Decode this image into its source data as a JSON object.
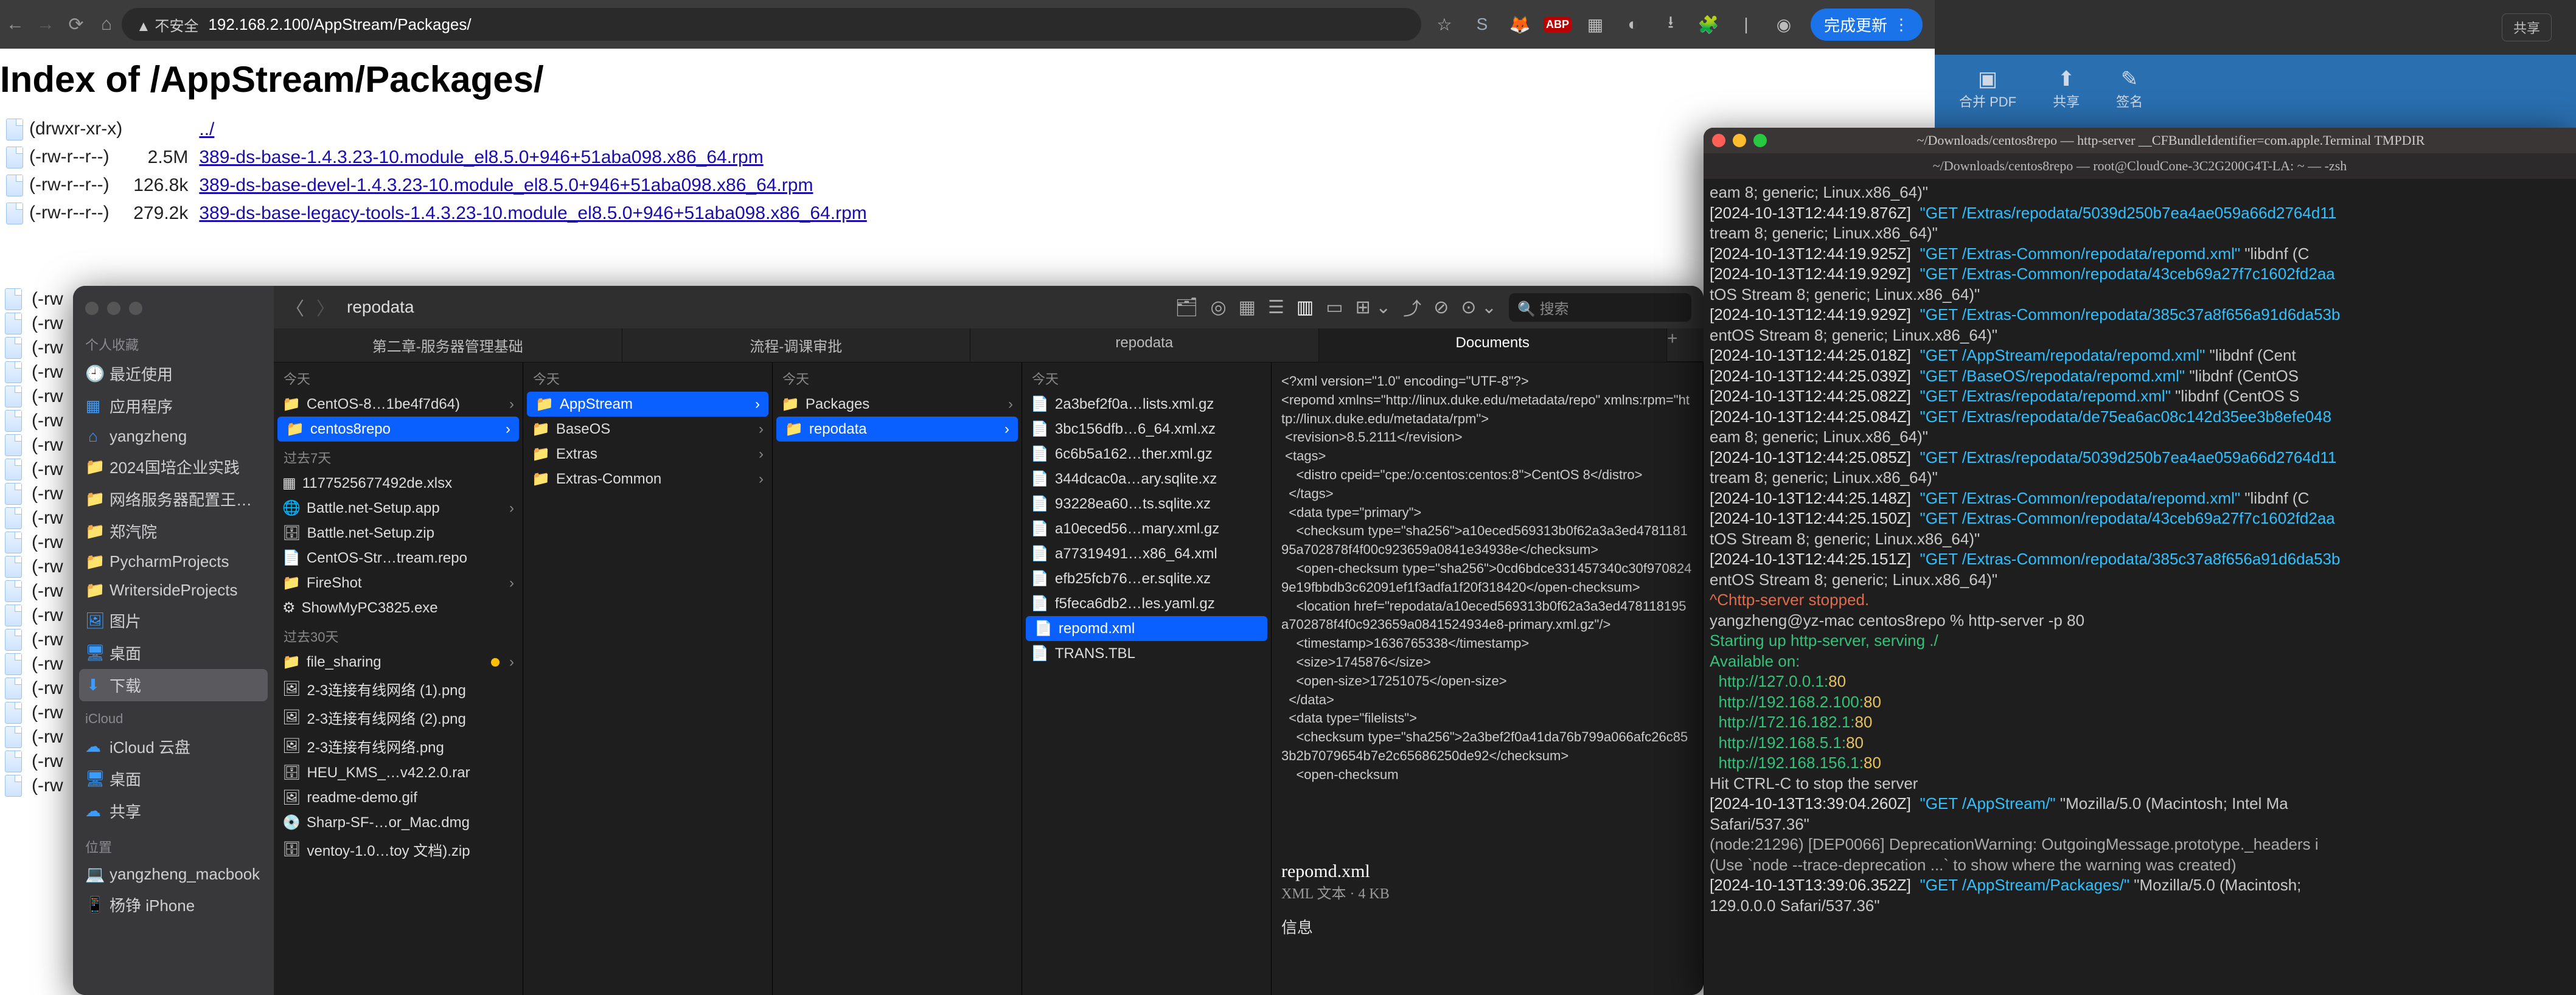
{
  "browser": {
    "security_badge": "▲ 不安全",
    "url": "192.168.2.100/AppStream/Packages/",
    "update_btn": "完成更新",
    "right_icons": [
      "star",
      "S",
      "fox",
      "abp",
      "grid",
      "ext",
      "dl",
      "puzzle",
      "sep",
      "globe"
    ]
  },
  "page": {
    "title": "Index of /AppStream/Packages/",
    "rows": [
      {
        "perm": "(drwxr-xr-x)",
        "size": "",
        "name": "../"
      },
      {
        "perm": "(-rw-r--r--)",
        "size": "2.5M",
        "name": "389-ds-base-1.4.3.23-10.module_el8.5.0+946+51aba098.x86_64.rpm"
      },
      {
        "perm": "(-rw-r--r--)",
        "size": "126.8k",
        "name": "389-ds-base-devel-1.4.3.23-10.module_el8.5.0+946+51aba098.x86_64.rpm"
      },
      {
        "perm": "(-rw-r--r--)",
        "size": "279.2k",
        "name": "389-ds-base-legacy-tools-1.4.3.23-10.module_el8.5.0+946+51aba098.x86_64.rpm"
      }
    ]
  },
  "stray_perms": [
    "(-rw",
    "(-rw",
    "(-rw",
    "(-rw",
    "(-rw",
    "(-rw",
    "(-rw",
    "(-rw",
    "(-rw",
    "(-rw",
    "(-rw",
    "(-rw",
    "(-rw",
    "(-rw",
    "(-rw",
    "(-rw",
    "(-rw",
    "(-rw",
    "(-rw",
    "(-rw",
    "(-rw"
  ],
  "finder": {
    "title": "repodata",
    "search_placeholder": "搜索",
    "sidebar": {
      "fav_head": "个人收藏",
      "fav": [
        {
          "icon": "🕘",
          "label": "最近使用"
        },
        {
          "icon": "▦",
          "label": "应用程序"
        },
        {
          "icon": "⌂",
          "label": "yangzheng"
        },
        {
          "icon": "📁",
          "label": "2024国培企业实践"
        },
        {
          "icon": "📁",
          "label": "网络服务器配置王…"
        },
        {
          "icon": "📁",
          "label": "郑汽院"
        },
        {
          "icon": "📁",
          "label": "PycharmProjects"
        },
        {
          "icon": "📁",
          "label": "WritersideProjects"
        },
        {
          "icon": "🖼",
          "label": "图片"
        },
        {
          "icon": "🖥",
          "label": "桌面",
          "sel": false
        },
        {
          "icon": "⬇",
          "label": "下载",
          "sel": true
        }
      ],
      "icloud_head": "iCloud",
      "icloud": [
        {
          "icon": "☁",
          "label": "iCloud 云盘"
        },
        {
          "icon": "🖥",
          "label": "桌面"
        },
        {
          "icon": "☁",
          "label": "共享"
        }
      ],
      "loc_head": "位置",
      "loc": [
        {
          "icon": "💻",
          "label": "yangzheng_macbook"
        },
        {
          "icon": "📱",
          "label": "杨铮 iPhone"
        }
      ]
    },
    "tabs": [
      {
        "label": "第二章-服务器管理基础"
      },
      {
        "label": "流程-调课审批"
      },
      {
        "label": "repodata"
      },
      {
        "label": "Documents",
        "act": true
      }
    ],
    "col1": {
      "groups": [
        {
          "head": "今天",
          "items": [
            {
              "icon": "📁",
              "label": "CentOS-8…1be4f7d64)",
              "chev": true
            },
            {
              "icon": "📁",
              "label": "centos8repo",
              "chev": true,
              "sel": true
            }
          ]
        },
        {
          "head": "过去7天",
          "items": [
            {
              "icon": "▦",
              "label": "1177525677492de.xlsx"
            },
            {
              "icon": "🌐",
              "label": "Battle.net-Setup.app",
              "chev": true
            },
            {
              "icon": "🗄",
              "label": "Battle.net-Setup.zip"
            },
            {
              "icon": "📄",
              "label": "CentOS-Str…tream.repo"
            },
            {
              "icon": "📁",
              "label": "FireShot",
              "chev": true
            },
            {
              "icon": "⚙",
              "label": "ShowMyPC3825.exe"
            }
          ]
        },
        {
          "head": "过去30天",
          "items": [
            {
              "icon": "📁",
              "label": "file_sharing",
              "dot": true,
              "chev": true
            },
            {
              "icon": "🖼",
              "label": "2-3连接有线网络 (1).png"
            },
            {
              "icon": "🖼",
              "label": "2-3连接有线网络 (2).png"
            },
            {
              "icon": "🖼",
              "label": "2-3连接有线网络.png"
            },
            {
              "icon": "🗄",
              "label": "HEU_KMS_…v42.2.0.rar"
            },
            {
              "icon": "🖼",
              "label": "readme-demo.gif"
            },
            {
              "icon": "💿",
              "label": "Sharp-SF-…or_Mac.dmg"
            },
            {
              "icon": "🗄",
              "label": "ventoy-1.0…toy 文档).zip"
            }
          ]
        }
      ]
    },
    "col2": {
      "groups": [
        {
          "head": "今天",
          "items": [
            {
              "icon": "📁",
              "label": "AppStream",
              "chev": true,
              "sel": true
            },
            {
              "icon": "📁",
              "label": "BaseOS",
              "chev": true
            },
            {
              "icon": "📁",
              "label": "Extras",
              "chev": true
            },
            {
              "icon": "📁",
              "label": "Extras-Common",
              "chev": true
            }
          ]
        }
      ]
    },
    "col3": {
      "groups": [
        {
          "head": "今天",
          "items": [
            {
              "icon": "📁",
              "label": "Packages",
              "chev": true
            },
            {
              "icon": "📁",
              "label": "repodata",
              "chev": true,
              "sel": true
            }
          ]
        }
      ]
    },
    "col4": {
      "groups": [
        {
          "head": "今天",
          "items": [
            {
              "icon": "📄",
              "label": "2a3bef2f0a…lists.xml.gz"
            },
            {
              "icon": "📄",
              "label": "3bc156dfb…6_64.xml.xz"
            },
            {
              "icon": "📄",
              "label": "6c6b5a162…ther.xml.gz"
            },
            {
              "icon": "📄",
              "label": "344dcac0a…ary.sqlite.xz"
            },
            {
              "icon": "📄",
              "label": "93228ea60…ts.sqlite.xz"
            },
            {
              "icon": "📄",
              "label": "a10eced56…mary.xml.gz"
            },
            {
              "icon": "📄",
              "label": "a77319491…x86_64.xml"
            },
            {
              "icon": "📄",
              "label": "efb25fcb76…er.sqlite.xz"
            },
            {
              "icon": "📄",
              "label": "f5feca6db2…les.yaml.gz"
            },
            {
              "icon": "📄",
              "label": "repomd.xml",
              "sel": true
            },
            {
              "icon": "📄",
              "label": "TRANS.TBL"
            }
          ]
        }
      ]
    },
    "preview": {
      "xml": "<?xml version=\"1.0\" encoding=\"UTF-8\"?>\n<repomd xmlns=\"http://linux.duke.edu/metadata/repo\" xmlns:rpm=\"http://linux.duke.edu/metadata/rpm\">\n <revision>8.5.2111</revision>\n <tags>\n    <distro cpeid=\"cpe:/o:centos:centos:8\">CentOS 8</distro>\n  </tags>\n  <data type=\"primary\">\n    <checksum type=\"sha256\">a10eced569313b0f62a3a3ed478118195a702878f4f00c923659a0841e34938e</checksum>\n    <open-checksum type=\"sha256\">0cd6bdce331457340c30f9708249e19fbbdb3c62091ef1f3adfa1f20f318420</open-checksum>\n    <location href=\"repodata/a10eced569313b0f62a3a3ed478118195a702878f4f0c923659a0841524934e8-primary.xml.gz\"/>\n    <timestamp>1636765338</timestamp>\n    <size>1745876</size>\n    <open-size>17251075</open-size>\n  </data>\n  <data type=\"filelists\">\n    <checksum type=\"sha256\">2a3bef2f0a41da76b799a066afc26c853b2b7079654b7e2c65686250de92</checksum>\n    <open-checksum",
      "filename": "repomd.xml",
      "subtitle": "XML 文本 · 4 KB",
      "info": "信息"
    }
  },
  "bg_panel": {
    "share": "共享",
    "icons": [
      {
        "label": "合并 PDF"
      },
      {
        "label": "共享"
      },
      {
        "label": "签名"
      }
    ]
  },
  "terminal": {
    "title": "~/Downloads/centos8repo — http-server __CFBundleIdentifier=com.apple.Terminal TMPDIR",
    "tabbar": "~/Downloads/centos8repo — root@CloudCone-3C2G200G4T-LA: ~ — -zsh",
    "lines": [
      {
        "t": "plain",
        "s": "eam 8; generic; Linux.x86_64)\""
      },
      {
        "t": "log",
        "ts": "[2024-10-13T12:44:19.876Z]",
        "get": "\"GET /Extras/repodata/5039d250b7ea4ae059a66d2764d11"
      },
      {
        "t": "plain",
        "s": "tream 8; generic; Linux.x86_64)\""
      },
      {
        "t": "log",
        "ts": "[2024-10-13T12:44:19.925Z]",
        "get": "\"GET /Extras-Common/repodata/repomd.xml\"",
        "tail": " \"libdnf (C"
      },
      {
        "t": "log",
        "ts": "[2024-10-13T12:44:19.929Z]",
        "get": "\"GET /Extras-Common/repodata/43ceb69a27f7c1602fd2aa"
      },
      {
        "t": "plain",
        "s": "tOS Stream 8; generic; Linux.x86_64)\""
      },
      {
        "t": "log",
        "ts": "[2024-10-13T12:44:19.929Z]",
        "get": "\"GET /Extras-Common/repodata/385c37a8f656a91d6da53b"
      },
      {
        "t": "plain",
        "s": "entOS Stream 8; generic; Linux.x86_64)\""
      },
      {
        "t": "log",
        "ts": "[2024-10-13T12:44:25.018Z]",
        "get": "\"GET /AppStream/repodata/repomd.xml\"",
        "tail": " \"libdnf (Cent"
      },
      {
        "t": "log",
        "ts": "[2024-10-13T12:44:25.039Z]",
        "get": "\"GET /BaseOS/repodata/repomd.xml\"",
        "tail": " \"libdnf (CentOS"
      },
      {
        "t": "log",
        "ts": "[2024-10-13T12:44:25.082Z]",
        "get": "\"GET /Extras/repodata/repomd.xml\"",
        "tail": " \"libdnf (CentOS S"
      },
      {
        "t": "log",
        "ts": "[2024-10-13T12:44:25.084Z]",
        "get": "\"GET /Extras/repodata/de75ea6ac08c142d35ee3b8efe048"
      },
      {
        "t": "plain",
        "s": "eam 8; generic; Linux.x86_64)\""
      },
      {
        "t": "log",
        "ts": "[2024-10-13T12:44:25.085Z]",
        "get": "\"GET /Extras/repodata/5039d250b7ea4ae059a66d2764d11"
      },
      {
        "t": "plain",
        "s": "tream 8; generic; Linux.x86_64)\""
      },
      {
        "t": "log",
        "ts": "[2024-10-13T12:44:25.148Z]",
        "get": "\"GET /Extras-Common/repodata/repomd.xml\"",
        "tail": " \"libdnf (C"
      },
      {
        "t": "log",
        "ts": "[2024-10-13T12:44:25.150Z]",
        "get": "\"GET /Extras-Common/repodata/43ceb69a27f7c1602fd2aa"
      },
      {
        "t": "plain",
        "s": "tOS Stream 8; generic; Linux.x86_64)\""
      },
      {
        "t": "log",
        "ts": "[2024-10-13T12:44:25.151Z]",
        "get": "\"GET /Extras-Common/repodata/385c37a8f656a91d6da53b"
      },
      {
        "t": "plain",
        "s": "entOS Stream 8; generic; Linux.x86_64)\""
      },
      {
        "t": "stop",
        "s": "^Chttp-server stopped."
      },
      {
        "t": "plain",
        "s": "yangzheng@yz-mac centos8repo % http-server -p 80"
      },
      {
        "t": "start",
        "s": "Starting up http-server, serving ./"
      },
      {
        "t": "avail",
        "s": "Available on:"
      },
      {
        "t": "addr",
        "s": "  http://127.0.0.1:",
        "port": "80"
      },
      {
        "t": "addr",
        "s": "  http://192.168.2.100:",
        "port": "80"
      },
      {
        "t": "addr",
        "s": "  http://172.16.182.1:",
        "port": "80"
      },
      {
        "t": "addr",
        "s": "  http://192.168.5.1:",
        "port": "80"
      },
      {
        "t": "addr",
        "s": "  http://192.168.156.1:",
        "port": "80"
      },
      {
        "t": "plain",
        "s": "Hit CTRL-C to stop the server"
      },
      {
        "t": "log",
        "ts": "[2024-10-13T13:39:04.260Z]",
        "get": "\"GET /AppStream/\"",
        "tail": " \"Mozilla/5.0 (Macintosh; Intel Ma"
      },
      {
        "t": "plain",
        "s": "Safari/537.36\""
      },
      {
        "t": "warn",
        "s": "(node:21296) [DEP0066] DeprecationWarning: OutgoingMessage.prototype._headers i"
      },
      {
        "t": "warn",
        "s": "(Use `node --trace-deprecation ...` to show where the warning was created)"
      },
      {
        "t": "log",
        "ts": "[2024-10-13T13:39:06.352Z]",
        "get": "\"GET /AppStream/Packages/\"",
        "tail": " \"Mozilla/5.0 (Macintosh;"
      },
      {
        "t": "plain",
        "s": "129.0.0.0 Safari/537.36\""
      }
    ]
  }
}
